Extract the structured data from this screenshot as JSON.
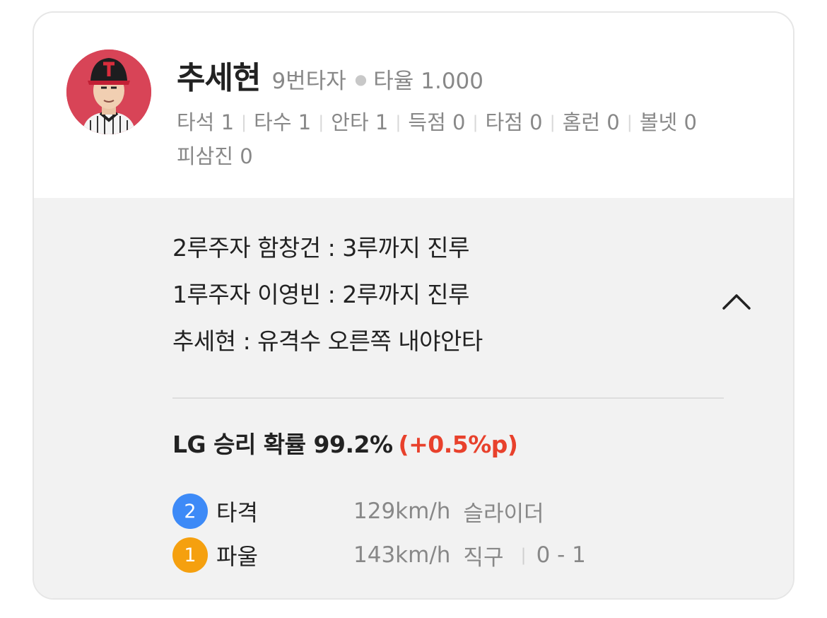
{
  "player": {
    "name": "추세현",
    "batting_order": "9번타자",
    "avg_label": "타율",
    "avg_value": "1.000",
    "avatar_icon": "player-photo",
    "stats": [
      {
        "label": "타석",
        "value": "1"
      },
      {
        "label": "타수",
        "value": "1"
      },
      {
        "label": "안타",
        "value": "1"
      },
      {
        "label": "득점",
        "value": "0"
      },
      {
        "label": "타점",
        "value": "0"
      },
      {
        "label": "홈런",
        "value": "0"
      },
      {
        "label": "볼넷",
        "value": "0"
      },
      {
        "label": "피삼진",
        "value": "0"
      }
    ]
  },
  "events": [
    "2루주자 함창건 : 3루까지 진루",
    "1루주자 이영빈 : 2루까지 진루",
    "추세현 : 유격수 오른쪽 내야안타"
  ],
  "collapse_icon": "chevron-up-icon",
  "win_probability": {
    "text": "LG 승리 확률 99.2%",
    "delta": "(+0.5%p)",
    "delta_color": "#e8412c"
  },
  "pitches": [
    {
      "number": "2",
      "result": "타격",
      "speed": "129km/h",
      "type": "슬라이더",
      "count": "",
      "badge_color": "#3d8af7"
    },
    {
      "number": "1",
      "result": "파울",
      "speed": "143km/h",
      "type": "직구",
      "count": "0 - 1",
      "badge_color": "#f5a00f"
    }
  ]
}
